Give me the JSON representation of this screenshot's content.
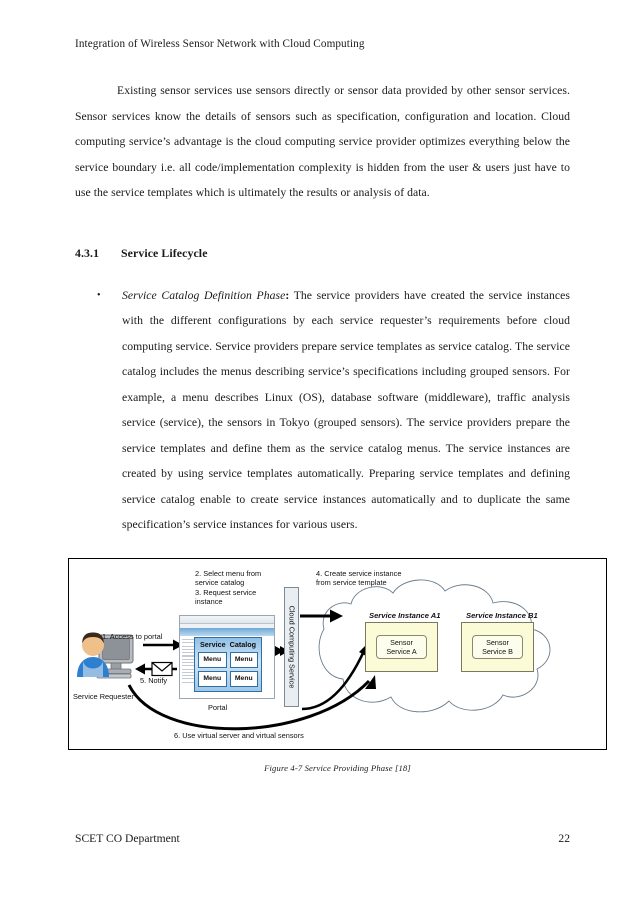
{
  "document": {
    "running_head": "Integration of Wireless Sensor Network with Cloud Computing",
    "paragraph_1": "Existing sensor services use sensors directly or sensor data provided by other sensor services. Sensor services know the details of sensors such as specification, configuration and location. Cloud computing service’s advantage is the cloud computing service provider optimizes everything below the service boundary i.e. all code/implementation complexity is hidden from the user & users just have to use the service templates which is ultimately the results or analysis of data.",
    "section": {
      "number": "4.3.1",
      "title": "Service Lifecycle"
    },
    "bullets": [
      {
        "marker": "•",
        "phase_label": "Service Catalog Definition Phase",
        "colon": ":",
        "text": " The service providers have created the service instances with the different configurations by each service requester’s requirements before cloud computing service. Service providers prepare service templates as service catalog. The service catalog includes the menus describing service’s specifications including grouped sensors. For example, a menu describes Linux (OS), database software (middleware), traffic analysis service (service), the sensors in Tokyo (grouped sensors). The service providers prepare the service templates and define them as the service catalog menus. The service instances are created by using service templates automatically. Preparing service templates and defining service catalog enable to create service instances automatically and to duplicate the same specification’s service instances for various users."
      }
    ],
    "figure": {
      "caption": "Figure 4-7 Service Providing Phase  [18]",
      "labels": {
        "step1": "1. Access to portal",
        "step2_3": "2. Select menu from\nservice catalog\n3. Request service\ninstance",
        "step4": "4. Create service instance\nfrom service template",
        "step5": "5. Notify",
        "step6": "6. Use virtual server and virtual sensors",
        "requester": "Service Requester",
        "portal": "Portal",
        "cloud_service": "Cloud Computing Service"
      },
      "catalog": {
        "head_left": "Service",
        "head_right": "Catalog",
        "menu_items": [
          "Menu",
          "Menu",
          "Menu",
          "Menu"
        ]
      },
      "instances": [
        {
          "title": "Service Instance A1",
          "sensor": "Sensor\nService A"
        },
        {
          "title": "Service Instance B1",
          "sensor": "Sensor\nService B"
        }
      ],
      "colors": {
        "instance_fill": "#fbfbd8",
        "sensor_fill": "#fdfdee",
        "catalog_border": "#2f6fa8",
        "cloud_bar_fill": "#e9eef3"
      }
    },
    "footer": {
      "left": "SCET CO Department",
      "page_number": "22"
    }
  }
}
